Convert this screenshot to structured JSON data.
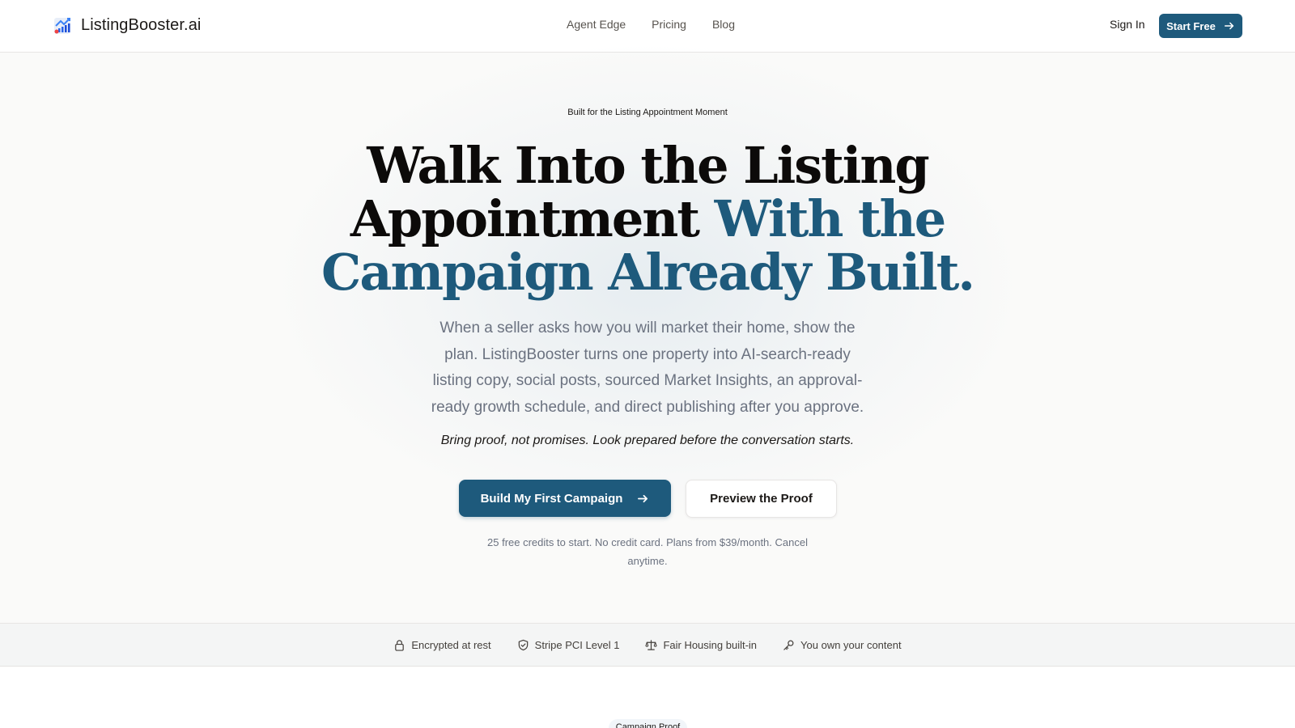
{
  "header": {
    "brand_name": "ListingBooster.ai",
    "logo_icon": "chart-house-logo-icon",
    "nav": [
      "Agent Edge",
      "Pricing",
      "Blog"
    ],
    "sign_in": "Sign In",
    "start_free": "Start Free"
  },
  "hero": {
    "eyebrow": "Built for the Listing Appointment Moment",
    "headline_line1": "Walk Into the Listing",
    "headline_line2_plain": "Appointment",
    "headline_line2_accent": "With the",
    "headline_line3_accent": "Campaign Already Built.",
    "subhead": "When a seller asks how you will market their home, show the plan. ListingBooster turns one property into AI-search-ready listing copy, social posts, sourced Market Insights, an approval-ready growth schedule, and direct publishing after you approve.",
    "tagline": "Bring proof, not promises. Look prepared before the conversation starts.",
    "primary_cta": "Build My First Campaign",
    "secondary_cta": "Preview the Proof",
    "fine_print": "25 free credits to start. No credit card. Plans from $39/month. Cancel anytime."
  },
  "trust": [
    {
      "icon": "lock-icon",
      "label": "Encrypted at rest"
    },
    {
      "icon": "shield-check-icon",
      "label": "Stripe PCI Level 1"
    },
    {
      "icon": "scale-icon",
      "label": "Fair Housing built-in"
    },
    {
      "icon": "key-icon",
      "label": "You own your content"
    }
  ],
  "next_section": {
    "pill": "Campaign Proof"
  },
  "colors": {
    "accent": "#1e5a7c",
    "background": "#fafaf9",
    "text": "#0c0a09"
  }
}
